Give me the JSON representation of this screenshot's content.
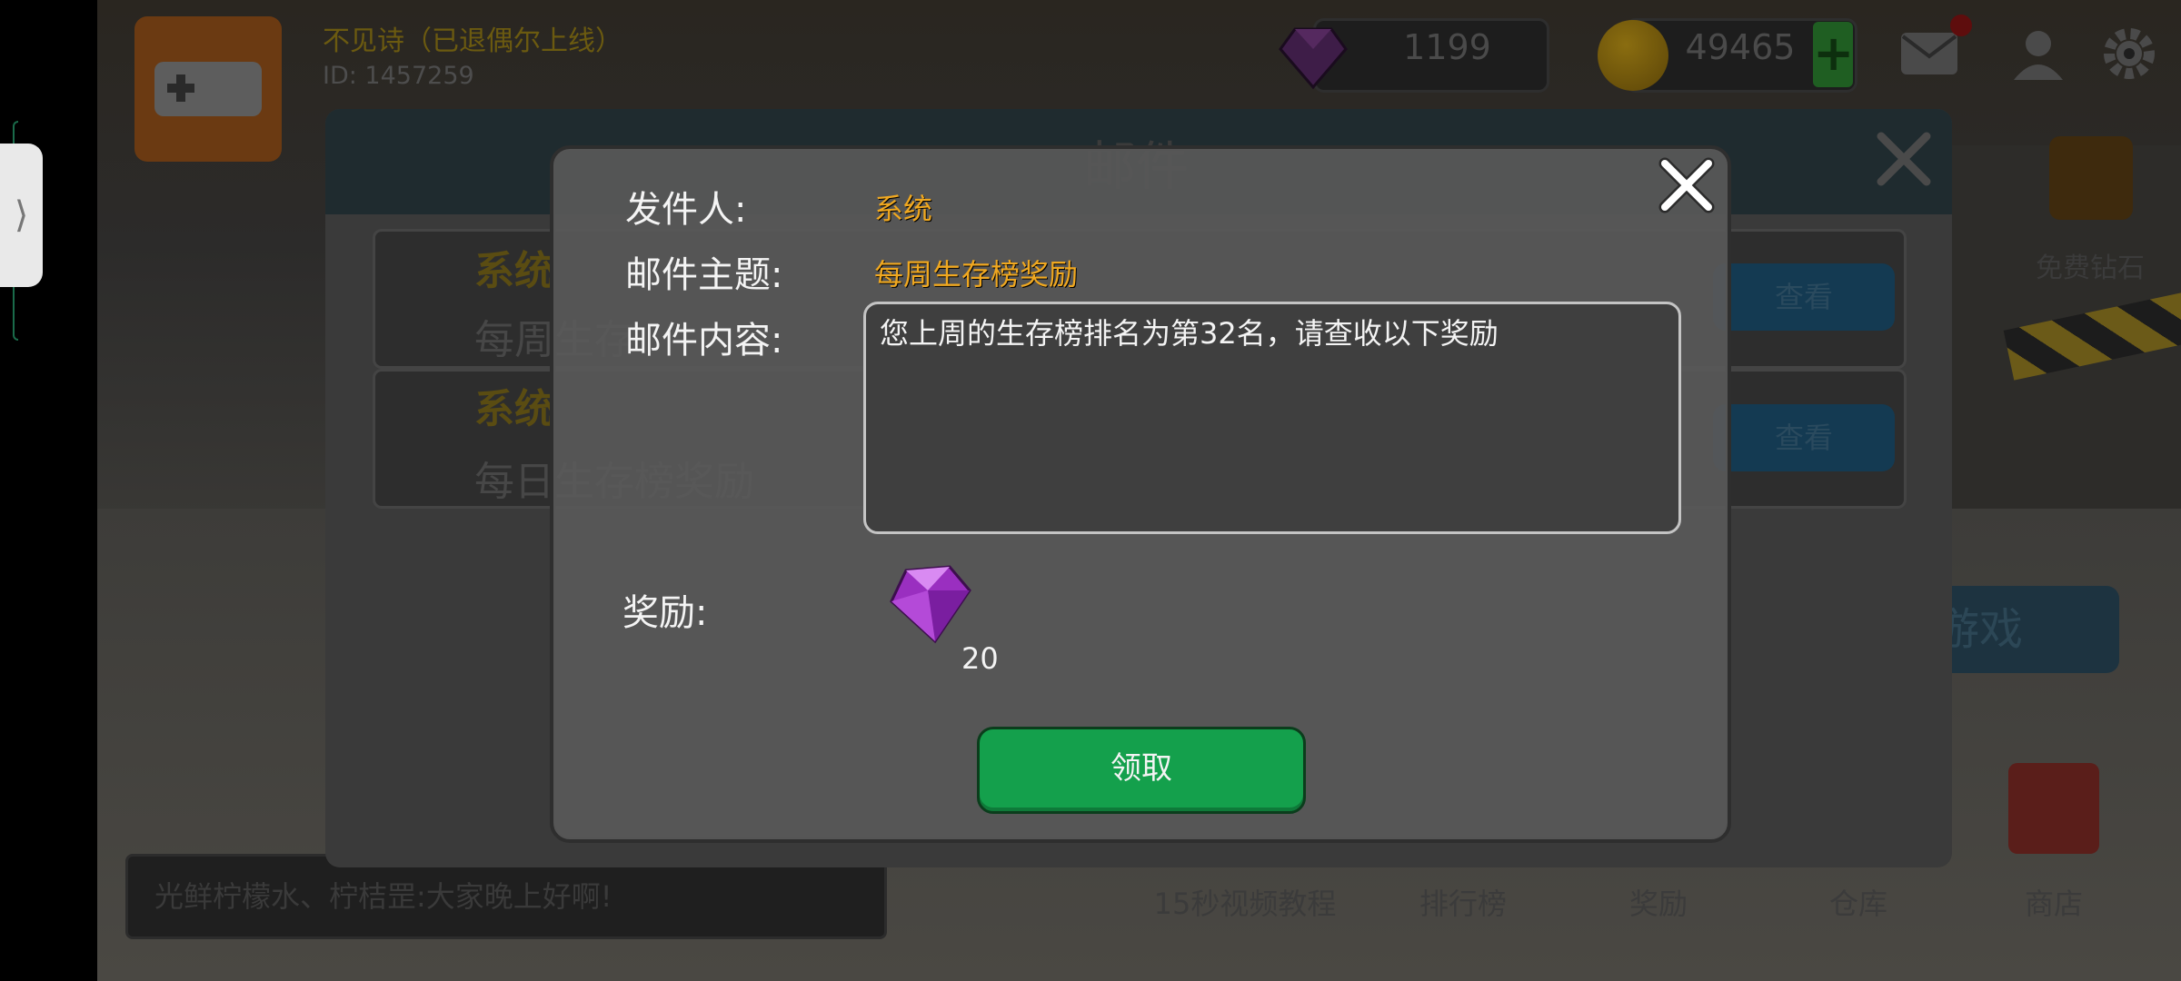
{
  "player": {
    "name": "不见诗（已退偶尔上线）",
    "id": "ID:  1457259"
  },
  "resources": {
    "gems": "1199",
    "coins": "49465",
    "plus": "+"
  },
  "side": {
    "free_gems": "免费钻石",
    "start_game": "开始游戏"
  },
  "bottom_nav": [
    {
      "label": "15秒视频教程"
    },
    {
      "label": "排行榜"
    },
    {
      "label": "奖励"
    },
    {
      "label": "仓库"
    },
    {
      "label": "商店"
    }
  ],
  "chat": {
    "message": "光鲜柠檬水、柠桔罡:大家晚上好啊!"
  },
  "mail_panel": {
    "title": "邮件",
    "rows": [
      {
        "sender": "系统",
        "subject": "每周生存",
        "view": "查看"
      },
      {
        "sender": "系统",
        "subject": "每日生存榜奖励",
        "view": "查看"
      }
    ]
  },
  "dialog": {
    "sender_label": "发件人:",
    "sender_value": "系统",
    "subject_label": "邮件主题:",
    "subject_value": "每周生存榜奖励",
    "content_label": "邮件内容:",
    "content_value": "您上周的生存榜排名为第32名，请查收以下奖励",
    "reward_label": "奖励:",
    "reward_count": "20",
    "claim_label": "领取"
  },
  "colors": {
    "accent_orange": "#f0a820",
    "claim_green": "#14a04c"
  },
  "icons": [
    "gem-icon",
    "coin-icon",
    "mail-icon",
    "friend-icon",
    "gear-icon",
    "close-icon",
    "video-icon"
  ]
}
